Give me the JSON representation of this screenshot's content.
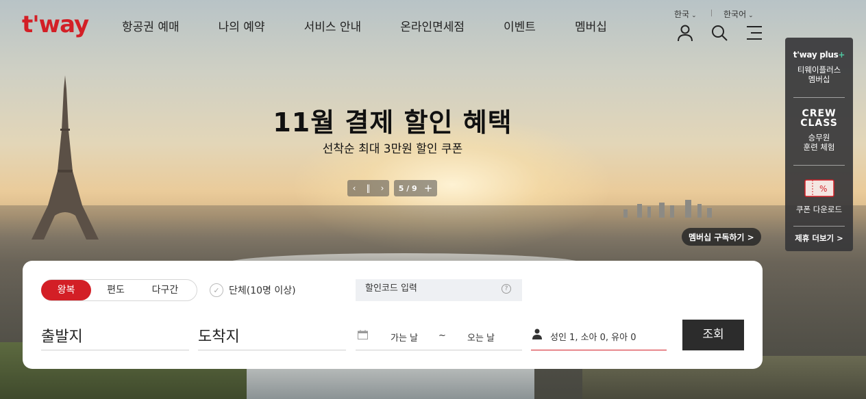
{
  "brand": {
    "logo_text": "t'way",
    "accent_color": "#d31f26"
  },
  "nav": {
    "items": [
      {
        "label": "항공권 예매"
      },
      {
        "label": "나의 예약"
      },
      {
        "label": "서비스 안내"
      },
      {
        "label": "온라인면세점"
      },
      {
        "label": "이벤트"
      },
      {
        "label": "멤버십"
      }
    ]
  },
  "header": {
    "region_label": "한국",
    "language_label": "한국어",
    "icons": [
      "user-icon",
      "search-icon",
      "menu-icon"
    ]
  },
  "banner": {
    "title": "11월 결제 할인 혜택",
    "subtitle": "선착순 최대 3만원 할인 쿠폰",
    "slide_counter": "5 / 9",
    "membership_button": "멤버십 구독하기 >"
  },
  "side_panel": {
    "plus_logo": "t'way plus",
    "plus_label_line1": "티웨이플러스",
    "plus_label_line2": "멤버십",
    "crew_logo_line1": "CREW",
    "crew_logo_line2": "CLASS",
    "crew_label_line1": "승무원",
    "crew_label_line2": "훈련 체험",
    "coupon_label": "쿠폰 다운로드",
    "more_label": "제휴 더보기 >"
  },
  "booking": {
    "trip_types": [
      {
        "label": "왕복",
        "active": true
      },
      {
        "label": "편도",
        "active": false
      },
      {
        "label": "다구간",
        "active": false
      }
    ],
    "group_label": "단체(10명 이상)",
    "promo_placeholder": "할인코드 입력",
    "origin_label": "출발지",
    "destination_label": "도착지",
    "departure_label": "가는 날",
    "date_separator": "~",
    "return_label": "오는 날",
    "passengers": "성인 1, 소아 0, 유아 0",
    "search_button": "조회"
  }
}
